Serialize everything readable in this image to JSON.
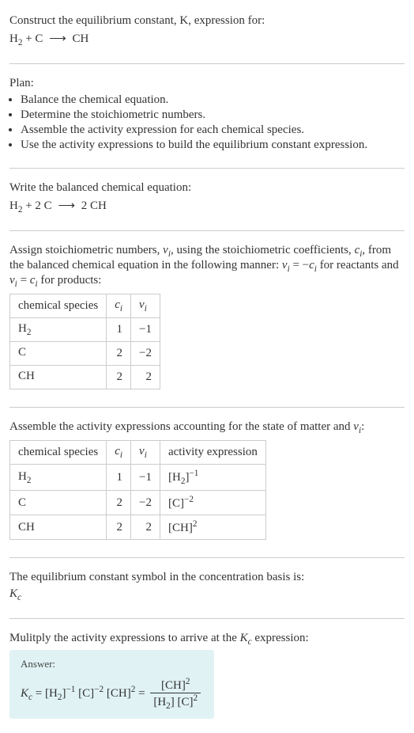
{
  "prompt": {
    "line1": "Construct the equilibrium constant, K, expression for:",
    "eq_lhs_a": "H",
    "eq_sub_a": "2",
    "eq_plus": " + C ",
    "eq_arrow": "⟶",
    "eq_rhs": " CH"
  },
  "plan": {
    "heading": "Plan:",
    "items": [
      "Balance the chemical equation.",
      "Determine the stoichiometric numbers.",
      "Assemble the activity expression for each chemical species.",
      "Use the activity expressions to build the equilibrium constant expression."
    ]
  },
  "balanced": {
    "heading": "Write the balanced chemical equation:",
    "eq_h": "H",
    "eq_h_sub": "2",
    "eq_mid": " + 2 C ",
    "eq_arrow": "⟶",
    "eq_rhs": " 2 CH"
  },
  "assign": {
    "text1": "Assign stoichiometric numbers, ",
    "nu": "ν",
    "nu_sub": "i",
    "text2": ", using the stoichiometric coefficients, ",
    "c": "c",
    "c_sub": "i",
    "text3": ", from the balanced chemical equation in the following manner: ",
    "rel1a": "ν",
    "rel1a_sub": "i",
    "rel1b": " = −",
    "rel1c": "c",
    "rel1c_sub": "i",
    "text4": " for reactants and ",
    "rel2a": "ν",
    "rel2a_sub": "i",
    "rel2b": " = ",
    "rel2c": "c",
    "rel2c_sub": "i",
    "text5": " for products:"
  },
  "table1": {
    "h1": "chemical species",
    "h2_a": "c",
    "h2_b": "i",
    "h3_a": "ν",
    "h3_b": "i",
    "rows": [
      {
        "sp_a": "H",
        "sp_sub": "2",
        "c": "1",
        "nu": "−1"
      },
      {
        "sp_a": "C",
        "sp_sub": "",
        "c": "2",
        "nu": "−2"
      },
      {
        "sp_a": "CH",
        "sp_sub": "",
        "c": "2",
        "nu": "2"
      }
    ]
  },
  "assemble": {
    "text1": "Assemble the activity expressions accounting for the state of matter and ",
    "nu": "ν",
    "nu_sub": "i",
    "text2": ":"
  },
  "table2": {
    "h1": "chemical species",
    "h2_a": "c",
    "h2_b": "i",
    "h3_a": "ν",
    "h3_b": "i",
    "h4": "activity expression",
    "rows": [
      {
        "sp_a": "H",
        "sp_sub": "2",
        "c": "1",
        "nu": "−1",
        "act_base_a": "[H",
        "act_base_sub": "2",
        "act_base_b": "]",
        "act_exp": "−1"
      },
      {
        "sp_a": "C",
        "sp_sub": "",
        "c": "2",
        "nu": "−2",
        "act_base_a": "[C",
        "act_base_sub": "",
        "act_base_b": "]",
        "act_exp": "−2"
      },
      {
        "sp_a": "CH",
        "sp_sub": "",
        "c": "2",
        "nu": "2",
        "act_base_a": "[CH",
        "act_base_sub": "",
        "act_base_b": "]",
        "act_exp": "2"
      }
    ]
  },
  "kcsymbol": {
    "text": "The equilibrium constant symbol in the concentration basis is:",
    "sym_a": "K",
    "sym_b": "c"
  },
  "multiply": {
    "text1": "Mulitply the activity expressions to arrive at the ",
    "kc_a": "K",
    "kc_b": "c",
    "text2": " expression:"
  },
  "answer": {
    "label": "Answer:",
    "kc_a": "K",
    "kc_b": "c",
    "eq": " = ",
    "t1_a": "[H",
    "t1_sub": "2",
    "t1_b": "]",
    "t1_exp": "−1",
    "t2_a": " [C]",
    "t2_exp": "−2",
    "t3_a": " [CH]",
    "t3_exp": "2",
    "eq2": " = ",
    "num_a": "[CH]",
    "num_exp": "2",
    "den1_a": "[H",
    "den1_sub": "2",
    "den1_b": "]",
    "den2_a": " [C]",
    "den2_exp": "2"
  }
}
